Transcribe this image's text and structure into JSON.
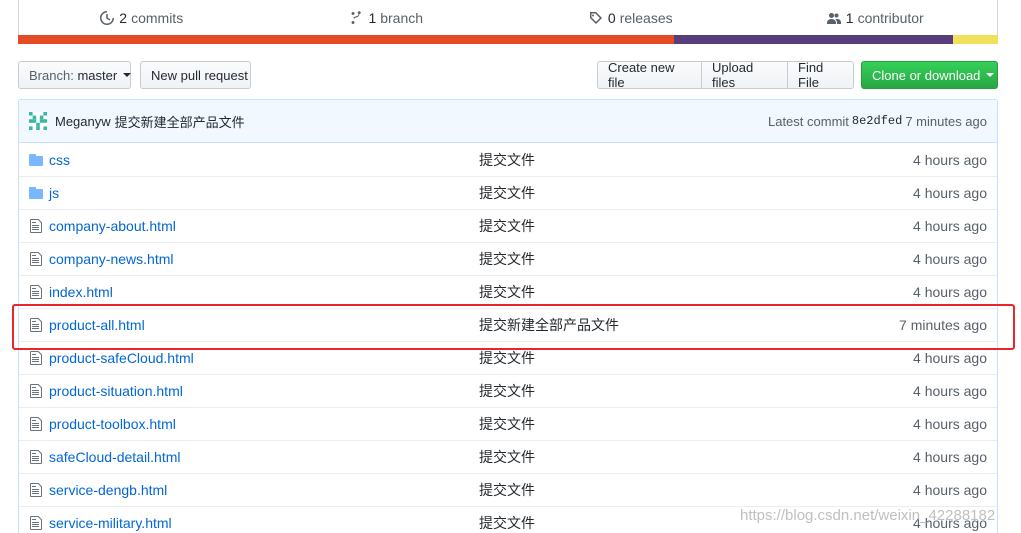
{
  "stats": {
    "commits_count": "2",
    "commits_label": "commits",
    "branch_count": "1",
    "branch_label": "branch",
    "releases_count": "0",
    "releases_label": "releases",
    "contributor_count": "1",
    "contributor_label": "contributor"
  },
  "language_bar": [
    {
      "color": "#e34c26",
      "fraction": 0.669
    },
    {
      "color": "#563d7c",
      "fraction": 0.285
    },
    {
      "color": "#f1e05a",
      "fraction": 0.046
    }
  ],
  "toolbar": {
    "branch_prefix": "Branch:",
    "branch_name": "master",
    "new_pull_request": "New pull request",
    "create_new_file": "Create new file",
    "upload_files": "Upload files",
    "find_file": "Find File",
    "clone_or_download": "Clone or download"
  },
  "commit": {
    "author": "Meganyw",
    "message": "提交新建全部产品文件",
    "latest_label": "Latest commit",
    "sha": "8e2dfed",
    "age": "7 minutes ago"
  },
  "files": [
    {
      "type": "dir",
      "name": "css",
      "message": "提交文件",
      "age": "4 hours ago"
    },
    {
      "type": "dir",
      "name": "js",
      "message": "提交文件",
      "age": "4 hours ago"
    },
    {
      "type": "file",
      "name": "company-about.html",
      "message": "提交文件",
      "age": "4 hours ago"
    },
    {
      "type": "file",
      "name": "company-news.html",
      "message": "提交文件",
      "age": "4 hours ago"
    },
    {
      "type": "file",
      "name": "index.html",
      "message": "提交文件",
      "age": "4 hours ago"
    },
    {
      "type": "file",
      "name": "product-all.html",
      "message": "提交新建全部产品文件",
      "age": "7 minutes ago"
    },
    {
      "type": "file",
      "name": "product-safeCloud.html",
      "message": "提交文件",
      "age": "4 hours ago"
    },
    {
      "type": "file",
      "name": "product-situation.html",
      "message": "提交文件",
      "age": "4 hours ago"
    },
    {
      "type": "file",
      "name": "product-toolbox.html",
      "message": "提交文件",
      "age": "4 hours ago"
    },
    {
      "type": "file",
      "name": "safeCloud-detail.html",
      "message": "提交文件",
      "age": "4 hours ago"
    },
    {
      "type": "file",
      "name": "service-dengb.html",
      "message": "提交文件",
      "age": "4 hours ago"
    },
    {
      "type": "file",
      "name": "service-military.html",
      "message": "提交文件",
      "age": "4 hours ago"
    }
  ],
  "watermark": "https://blog.csdn.net/weixin_42288182",
  "colors": {
    "link": "#0366d6",
    "highlight": "#e8262c",
    "primary_button": "#28a745"
  }
}
